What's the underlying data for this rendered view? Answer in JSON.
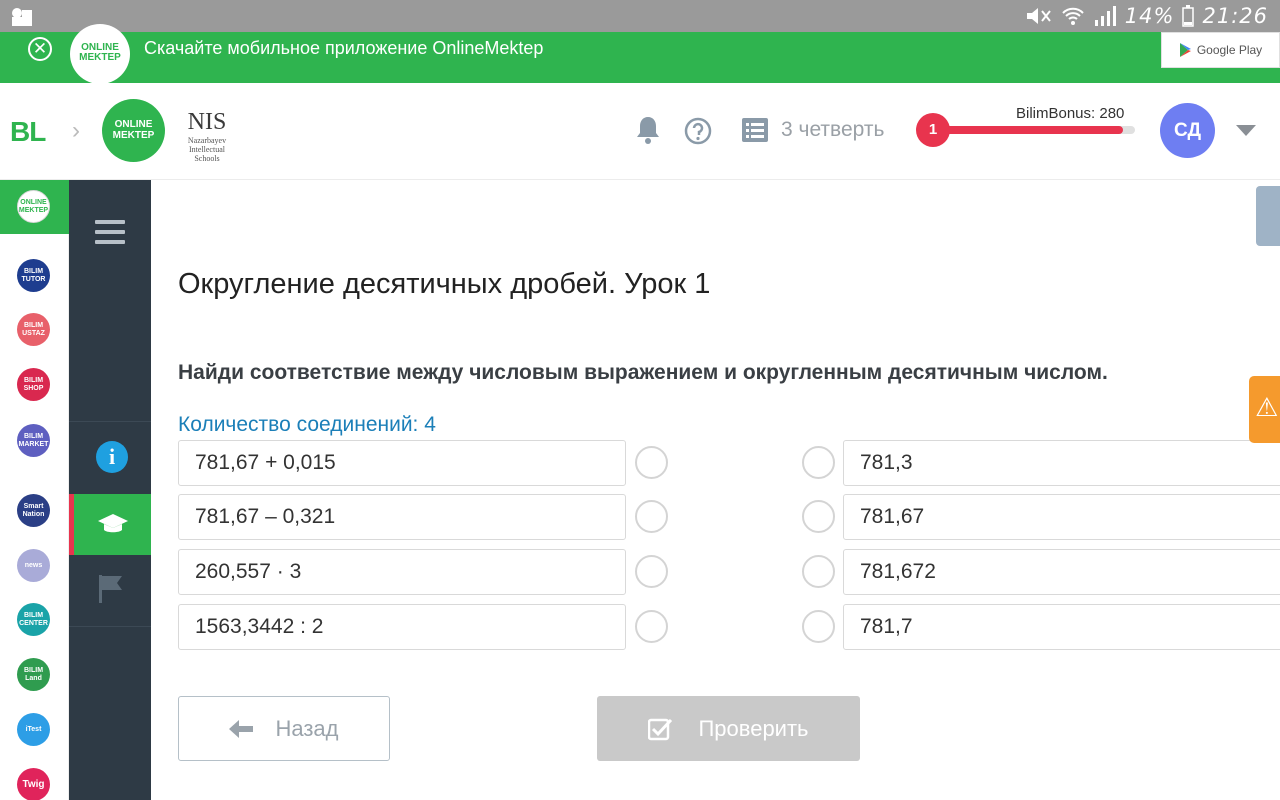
{
  "status_bar": {
    "battery": "14%",
    "time": "21:26"
  },
  "banner": {
    "text": "Скачайте мобильное приложение OnlineMektep",
    "store_label": "Google Play",
    "logo_text": "ONLINE MEKTEP"
  },
  "header": {
    "bl_logo": "BL",
    "om_logo": "ONLINE MEKTEP",
    "nis_title": "NIS",
    "nis_subtitle": "Nazarbayev Intellectual Schools",
    "quarter": "3 четверть",
    "level": "1",
    "bonus_label": "BilimBonus: 280",
    "bonus_fill_fraction": 0.94,
    "avatar_initials": "СД"
  },
  "rail": {
    "items": [
      {
        "label": "ONLINE MEKTEP",
        "color": "#ffffff"
      },
      {
        "label": "BILIM TUTOR",
        "color": "#1e3d8f"
      },
      {
        "label": "BILIM USTAZ",
        "color": "#e8606a"
      },
      {
        "label": "BILIM SHOP",
        "color": "#d9284f"
      },
      {
        "label": "BILIM MARKET",
        "color": "#5e5fc0"
      },
      {
        "label": "Smart Nation",
        "color": "#2b3f86"
      },
      {
        "label": "news",
        "color": "#a9abd8"
      },
      {
        "label": "BILIM CENTER",
        "color": "#1aa3a8"
      },
      {
        "label": "BILIM Land",
        "color": "#2f9c4f"
      },
      {
        "label": "iTest",
        "color": "#2d9ee6"
      },
      {
        "label": "Twig",
        "color": "#e0245b"
      }
    ]
  },
  "lesson": {
    "title": "Округление десятичных дробей. Урок 1",
    "question": "Найди соответствие между числовым выражением и округленным десятичным числом.",
    "connections": "Количество соединений: 4",
    "left": [
      "781,67 + 0,015",
      "781,67 – 0,321",
      "260,557 · 3",
      "1563,3442 : 2"
    ],
    "right": [
      "781,3",
      "781,67",
      "781,672",
      "781,7"
    ]
  },
  "buttons": {
    "back": "Назад",
    "check": "Проверить"
  },
  "colors": {
    "brand_green": "#2fb44f",
    "sidebar_dark": "#2e3a45",
    "accent_red": "#e8344e",
    "link_blue": "#1b7fb8"
  }
}
